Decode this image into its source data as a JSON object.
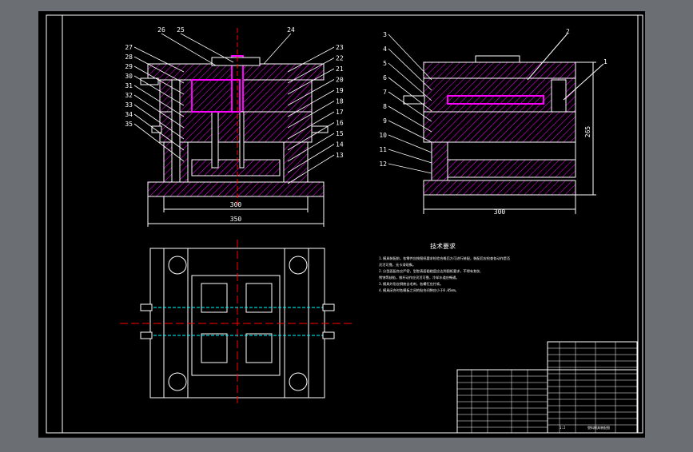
{
  "colors": {
    "background": "#000000",
    "frame": "#ffffff",
    "hatch": "#ff00ff",
    "outline": "#ffffff",
    "centerline": "#ff0000",
    "cyan": "#00ffff",
    "yellow": "#ffff00",
    "green": "#00ff00",
    "blue": "#4040ff",
    "outer": "#6b6f74"
  },
  "left_view": {
    "callouts_left": [
      "27",
      "28",
      "29",
      "30",
      "31",
      "32",
      "33",
      "34",
      "35"
    ],
    "callouts_top": [
      "26",
      "25",
      "24"
    ],
    "callouts_right": [
      "23",
      "22",
      "21",
      "20",
      "19",
      "18",
      "17",
      "16",
      "15",
      "14",
      "13"
    ],
    "dim_inner": "300",
    "dim_outer": "350"
  },
  "right_view": {
    "callouts_left": [
      "3",
      "4",
      "5",
      "6",
      "7",
      "8",
      "9",
      "10",
      "11",
      "12"
    ],
    "callout_top": "2",
    "callout_right": "1",
    "dim_width": "300",
    "dim_height": "265"
  },
  "notes": {
    "title": "技术要求",
    "lines": [
      "1.模具装配前，各零件应按图纸要求检验合格后方可进行装配，装配后应检查各动作是否",
      "灵活可靠，无卡滞现象。",
      "2.分型面配合应严密，型腔表面粗糙度应达到图纸要求，不得有划伤、",
      "锈蚀等缺陷，推杆动作应灵活可靠，冷却水道应畅通。",
      "3.模具外形应倒棱去毛刺，各螺钉应拧紧。",
      "4.模具闭合时各模板之间的贴合间隙应小于0.05mm。"
    ]
  },
  "title_block": {
    "drawing_title": "塑料模具装配图",
    "scale": "1:2"
  }
}
